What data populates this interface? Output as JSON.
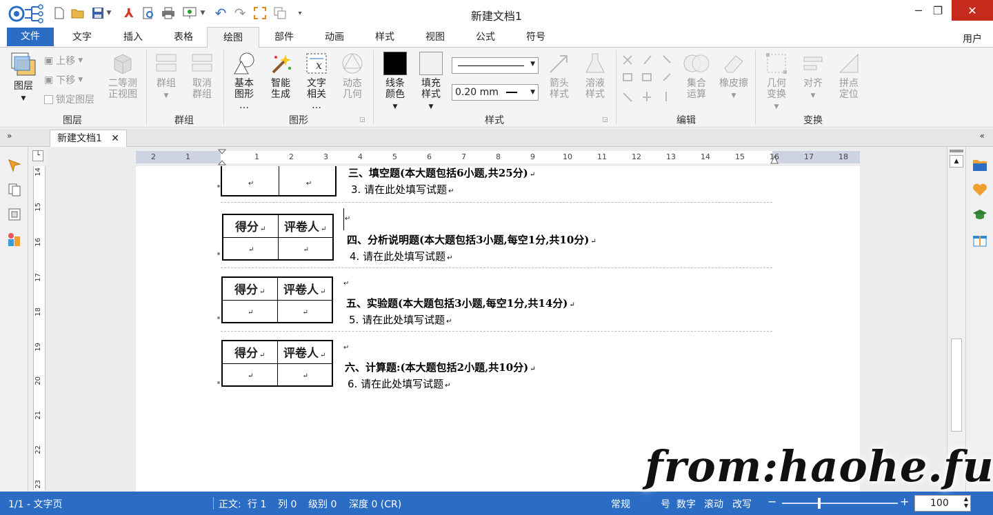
{
  "window": {
    "title": "新建文档1"
  },
  "tabs": [
    "文件",
    "文字",
    "插入",
    "表格",
    "绘图",
    "部件",
    "动画",
    "样式",
    "视图",
    "公式",
    "符号"
  ],
  "user_label": "用户",
  "ribbon": {
    "layer": {
      "label": "图层",
      "up": "上移",
      "down": "下移",
      "lock": "锁定图层",
      "iso_line1": "二等测",
      "iso_line2": "正视图",
      "group": "图层"
    },
    "grouping": {
      "group_btn": "群组",
      "ungroup_line1": "取消",
      "ungroup_line2": "群组",
      "group": "群组"
    },
    "shapes": {
      "basic_line1": "基本",
      "basic_line2": "图形",
      "smart_line1": "智能",
      "smart_line2": "生成",
      "text_line1": "文字",
      "text_line2": "相关",
      "dyn_line1": "动态",
      "dyn_line2": "几何",
      "group": "图形"
    },
    "style": {
      "line_color_1": "线条",
      "line_color_2": "颜色",
      "fill_1": "填充",
      "fill_2": "样式",
      "line_width": "0.20 mm",
      "arrow_1": "箭头",
      "arrow_2": "样式",
      "sol_1": "溶液",
      "sol_2": "样式",
      "group": "样式"
    },
    "edit": {
      "set_1": "集合",
      "set_2": "运算",
      "eraser": "橡皮擦",
      "group": "编辑"
    },
    "transform": {
      "geo_1": "几何",
      "geo_2": "变换",
      "align": "对齐",
      "snap_1": "拼点",
      "snap_2": "定位",
      "group": "变换"
    }
  },
  "doc_tab": "新建文档1",
  "ruler_numbers": [
    "2",
    "1",
    "1",
    "2",
    "3",
    "4",
    "5",
    "6",
    "7",
    "8",
    "9",
    "10",
    "11",
    "12",
    "13",
    "14",
    "15",
    "16",
    "17",
    "18"
  ],
  "vruler_numbers": [
    "14",
    "15",
    "16",
    "17",
    "18",
    "19",
    "20",
    "21",
    "22",
    "23"
  ],
  "score_table": {
    "score": "得分",
    "grader": "评卷人"
  },
  "return_mark": "↵",
  "sections": [
    {
      "heading": "三、填空题(本大题包括6小题,共25分)",
      "item": "3.  请在此处填写试题"
    },
    {
      "heading": "四、分析说明题(本大题包括3小题,每空1分,共10分)",
      "item": "4.  请在此处填写试题"
    },
    {
      "heading": "五、实验题(本大题包括3小题,每空1分,共14分)",
      "item": "5.  请在此处填写试题"
    },
    {
      "heading": "六、计算题:(本大题包括2小题,共10分)",
      "item": "6.  请在此处填写试题"
    }
  ],
  "status": {
    "page": "1/1 - 文字页",
    "body": "正文:",
    "row": "行 1",
    "col": "列 0",
    "level": "级别 0",
    "depth": "深度 0 (CR)",
    "normal": "常规",
    "num": "号",
    "digit": "数字",
    "scroll": "滚动",
    "revise": "改写",
    "zoom": "100"
  },
  "watermark": "from:haohe.fun"
}
